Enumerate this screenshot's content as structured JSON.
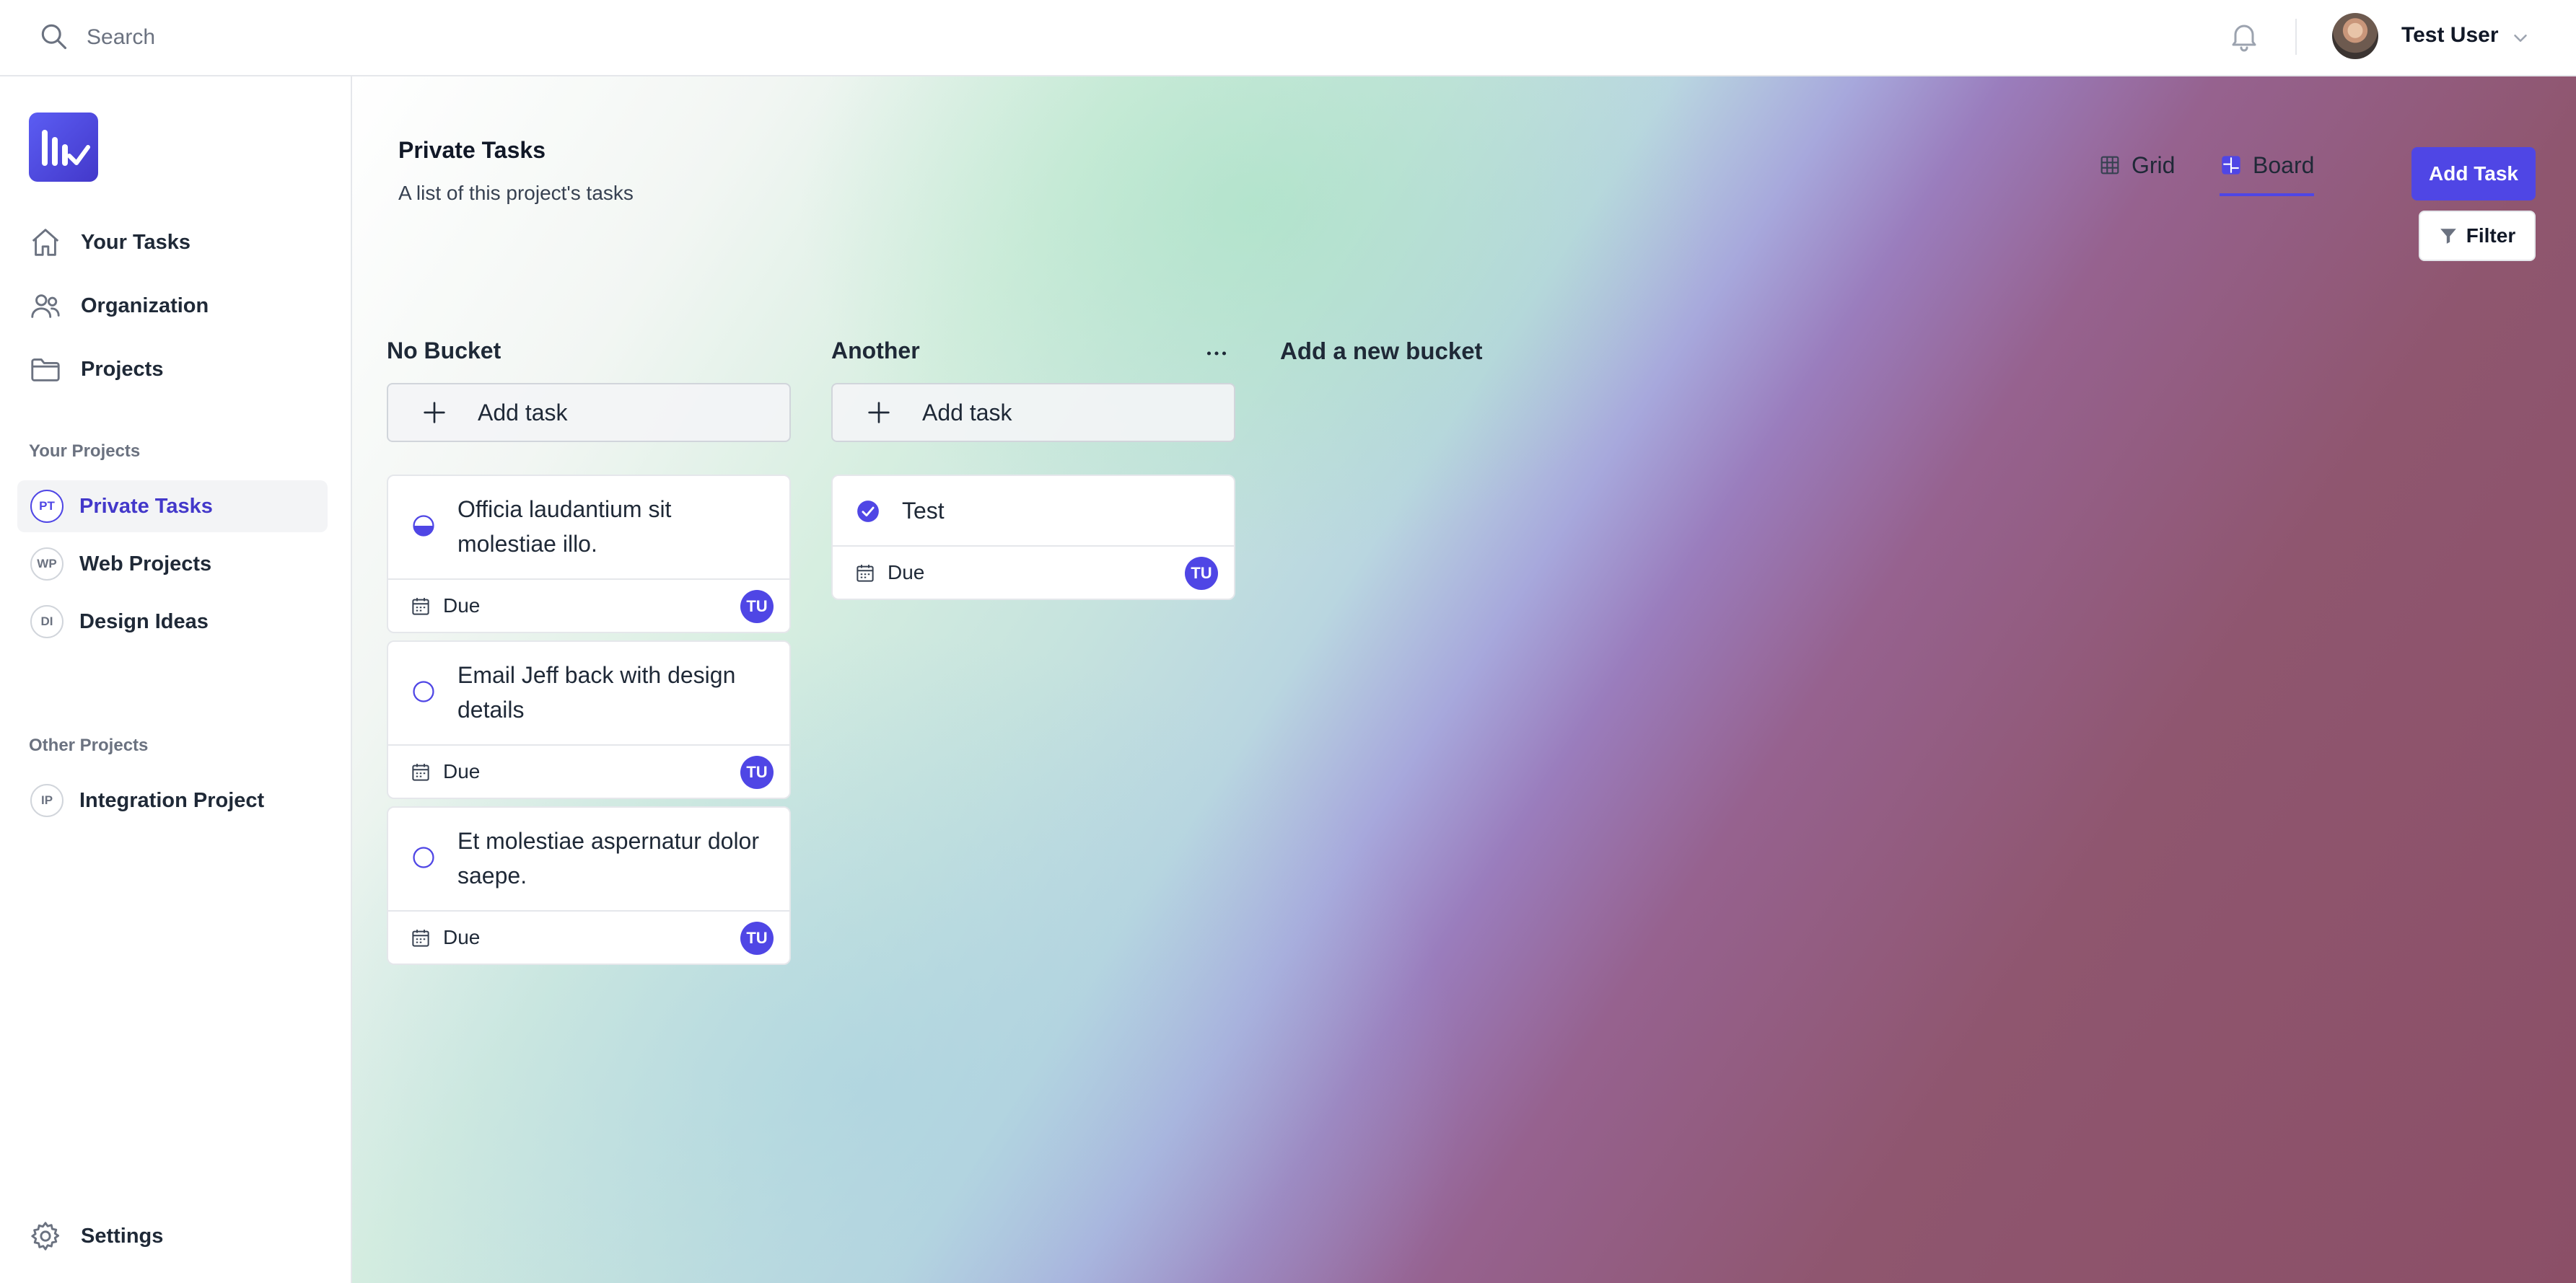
{
  "topbar": {
    "search_placeholder": "Search",
    "user_name": "Test User",
    "icons": {
      "search": "search-icon",
      "notifications": "bell-icon",
      "menu": "chevron-down-icon"
    }
  },
  "sidebar": {
    "nav": [
      {
        "label": "Your Tasks",
        "icon": "home-icon"
      },
      {
        "label": "Organization",
        "icon": "users-icon"
      },
      {
        "label": "Projects",
        "icon": "folder-icon"
      }
    ],
    "your_projects_label": "Your Projects",
    "your_projects": [
      {
        "badge": "PT",
        "label": "Private Tasks",
        "active": true
      },
      {
        "badge": "WP",
        "label": "Web Projects"
      },
      {
        "badge": "DI",
        "label": "Design Ideas"
      }
    ],
    "other_projects_label": "Other Projects",
    "other_projects": [
      {
        "badge": "IP",
        "label": "Integration Project"
      }
    ],
    "settings_label": "Settings"
  },
  "header": {
    "title": "Private Tasks",
    "subtitle": "A list of this project's tasks",
    "tabs": [
      {
        "label": "Grid",
        "active": false
      },
      {
        "label": "Board",
        "active": true
      }
    ],
    "add_task_label": "Add Task",
    "filter_label": "Filter"
  },
  "buckets": [
    {
      "title": "No Bucket",
      "add_label": "Add task",
      "tasks": [
        {
          "title": "Officia laudantium sit molestiae illo.",
          "status": "in-progress",
          "due_label": "Due",
          "assignee": "TU"
        },
        {
          "title": "Email Jeff back with design details",
          "status": "open",
          "due_label": "Due",
          "assignee": "TU"
        },
        {
          "title": "Et molestiae aspernatur dolor saepe.",
          "status": "open",
          "due_label": "Due",
          "assignee": "TU"
        }
      ]
    },
    {
      "title": "Another",
      "add_label": "Add task",
      "tasks": [
        {
          "title": "Test",
          "status": "done",
          "due_label": "Due",
          "assignee": "TU"
        }
      ]
    }
  ],
  "new_bucket_label": "Add a new bucket",
  "colors": {
    "accent": "#4f46e5",
    "active_nav_bg": "#f3f4f6"
  }
}
